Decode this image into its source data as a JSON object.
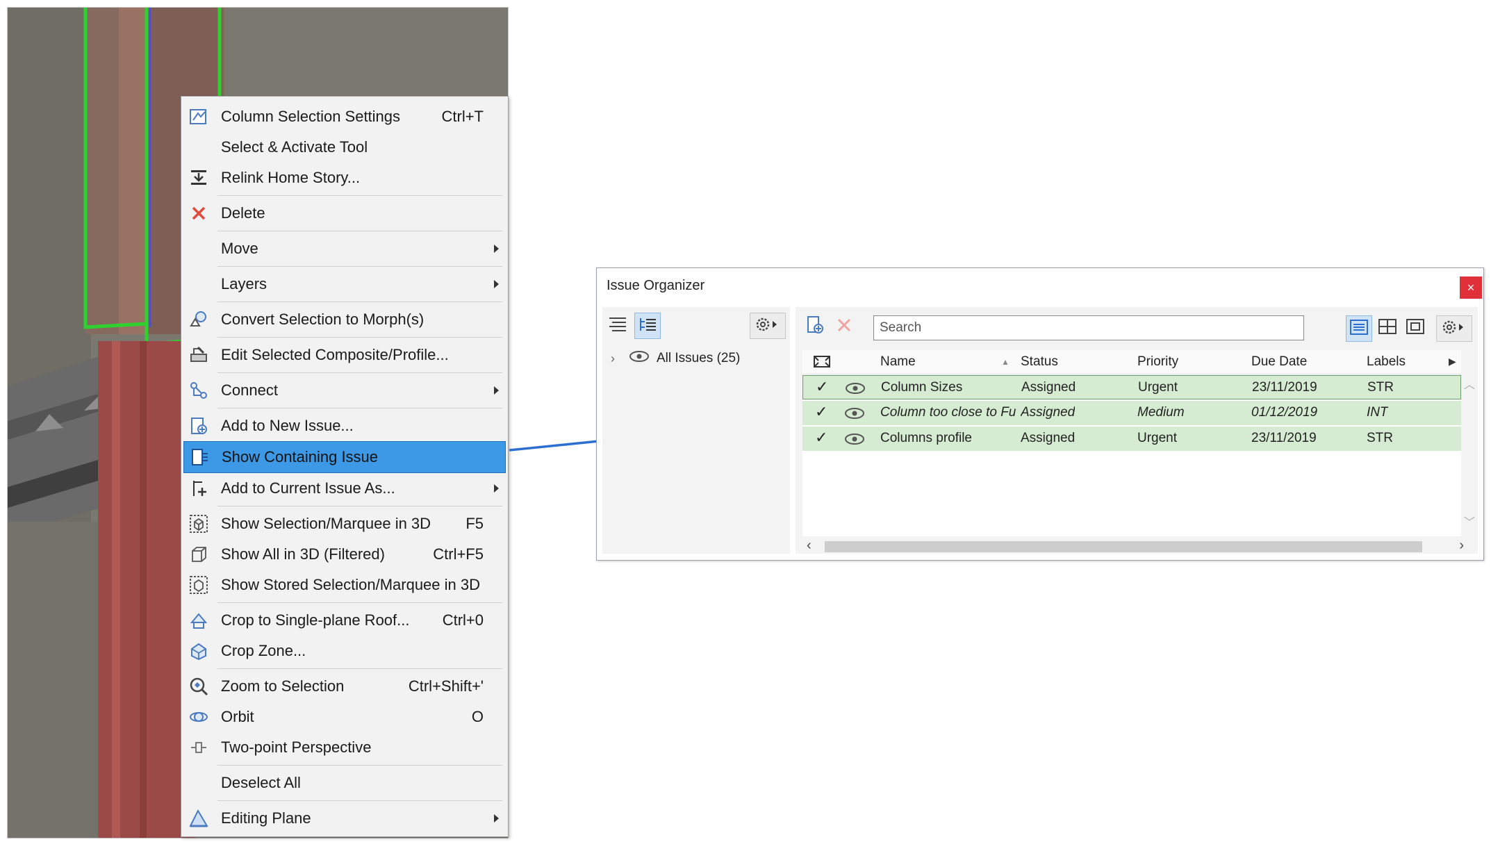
{
  "context_menu": {
    "items": [
      {
        "label": "Column Selection Settings",
        "shortcut": "Ctrl+T",
        "icon": "column-settings-icon"
      },
      {
        "label": "Select & Activate Tool",
        "shortcut": "",
        "icon": ""
      },
      {
        "label": "Relink Home Story...",
        "shortcut": "",
        "icon": "relink-story-icon"
      },
      {
        "label": "Delete",
        "shortcut": "",
        "icon": "delete-icon"
      },
      {
        "label": "Move",
        "shortcut": "",
        "icon": "",
        "submenu": true
      },
      {
        "label": "Layers",
        "shortcut": "",
        "icon": "",
        "submenu": true
      },
      {
        "label": "Convert Selection to Morph(s)",
        "shortcut": "",
        "icon": "morph-icon"
      },
      {
        "label": "Edit Selected Composite/Profile...",
        "shortcut": "",
        "icon": "composite-profile-icon"
      },
      {
        "label": "Connect",
        "shortcut": "",
        "icon": "connect-icon",
        "submenu": true
      },
      {
        "label": "Add to New Issue...",
        "shortcut": "",
        "icon": "add-new-issue-icon"
      },
      {
        "label": "Show Containing Issue",
        "shortcut": "",
        "icon": "show-issue-icon",
        "highlighted": true
      },
      {
        "label": "Add to Current Issue As...",
        "shortcut": "",
        "icon": "add-current-issue-icon",
        "submenu": true
      },
      {
        "label": "Show Selection/Marquee in 3D",
        "shortcut": "F5",
        "icon": "show-3d-icon"
      },
      {
        "label": "Show All in 3D (Filtered)",
        "shortcut": "Ctrl+F5",
        "icon": "show-all-3d-icon"
      },
      {
        "label": "Show Stored Selection/Marquee in 3D",
        "shortcut": "",
        "icon": "stored-selection-3d-icon"
      },
      {
        "label": "Crop to Single-plane Roof...",
        "shortcut": "Ctrl+0",
        "icon": "crop-roof-icon"
      },
      {
        "label": "Crop Zone...",
        "shortcut": "",
        "icon": "crop-zone-icon"
      },
      {
        "label": "Zoom to Selection",
        "shortcut": "Ctrl+Shift+'",
        "icon": "zoom-selection-icon"
      },
      {
        "label": "Orbit",
        "shortcut": "O",
        "icon": "orbit-icon"
      },
      {
        "label": "Two-point Perspective",
        "shortcut": "",
        "icon": "perspective-icon"
      },
      {
        "label": "Deselect All",
        "shortcut": "",
        "icon": ""
      },
      {
        "label": "Editing Plane",
        "shortcut": "",
        "icon": "editing-plane-icon",
        "submenu": true
      }
    ]
  },
  "issue_organizer": {
    "title": "Issue Organizer",
    "close_label": "×",
    "search_placeholder": "Search",
    "tree": {
      "root_label": "All Issues (25)"
    },
    "columns": [
      "Name",
      "Status",
      "Priority",
      "Due Date",
      "Labels"
    ],
    "rows": [
      {
        "check": "✓",
        "name": "Column Sizes",
        "status": "Assigned",
        "priority": "Urgent",
        "due": "23/11/2019",
        "label": "STR"
      },
      {
        "check": "✓",
        "name": "Column too close to Fu",
        "status": "Assigned",
        "priority": "Medium",
        "due": "01/12/2019",
        "label": "INT"
      },
      {
        "check": "✓",
        "name": "Columns profile",
        "status": "Assigned",
        "priority": "Urgent",
        "due": "23/11/2019",
        "label": "STR"
      }
    ]
  },
  "colors": {
    "highlight": "#3d99e6",
    "row_green": "#d6ecd2",
    "arrow": "#2d6fd0",
    "close_red": "#e0303a",
    "column_red": "#9b4a47",
    "selection_green": "#2ed12e"
  }
}
